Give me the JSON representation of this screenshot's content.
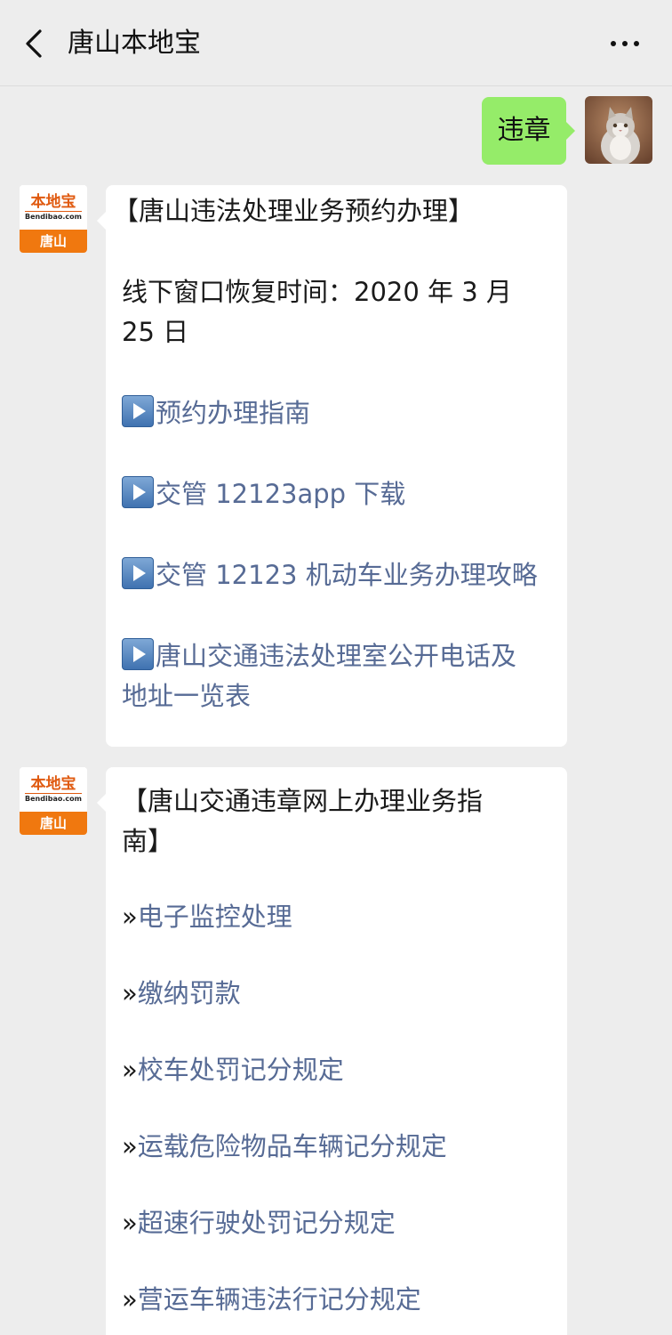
{
  "header": {
    "title": "唐山本地宝"
  },
  "sent_message": {
    "text": "违章"
  },
  "bot": {
    "avatar_brand": "本地宝",
    "avatar_domain": "Bendibao.com",
    "avatar_city": "唐山"
  },
  "message1": {
    "title": "【唐山违法处理业务预约办理】",
    "notice_line1": "线下窗口恢复时间：2020 年 3 月",
    "notice_line2": "25 日",
    "links": [
      "预约办理指南",
      "交管 12123app 下载",
      "交管 12123 机动车业务办理攻略",
      "唐山交通违法处理室公开电话及",
      "地址一览表"
    ]
  },
  "message2": {
    "title_line1": "【唐山交通违章网上办理业务指",
    "title_line2": "南】",
    "links": [
      "电子监控处理",
      "缴纳罚款",
      "校车处罚记分规定",
      "运载危险物品车辆记分规定",
      "超速行驶处罚记分规定",
      "营运车辆违法行记分规定"
    ]
  },
  "colors": {
    "background": "#ededed",
    "sent_bubble": "#95ec69",
    "link": "#576b95",
    "brand_orange": "#f0780f"
  }
}
